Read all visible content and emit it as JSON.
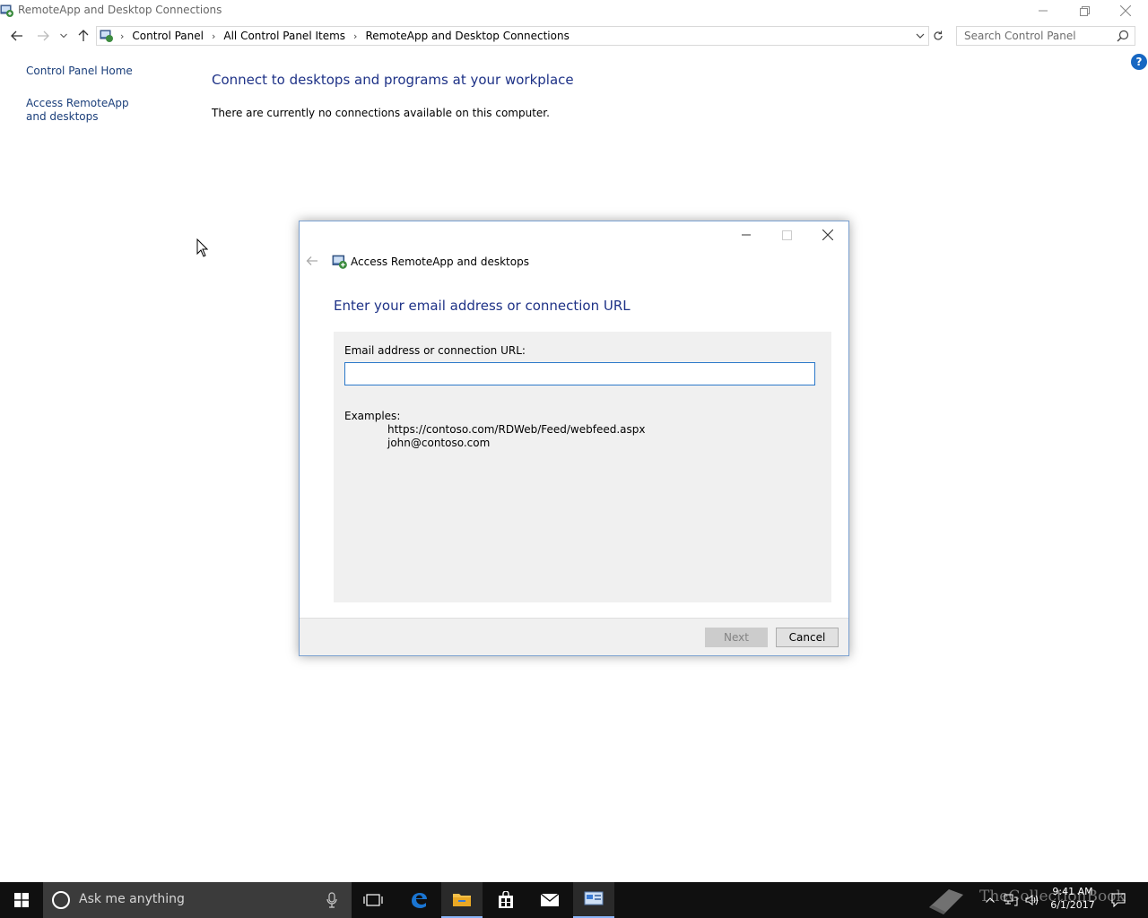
{
  "window": {
    "title": "RemoteApp and Desktop Connections"
  },
  "address": {
    "crumbs": [
      "Control Panel",
      "All Control Panel Items",
      "RemoteApp and Desktop Connections"
    ]
  },
  "search": {
    "placeholder": "Search Control Panel"
  },
  "help": {
    "label": "?"
  },
  "left_pane": {
    "home": "Control Panel Home",
    "access": "Access RemoteApp and desktops"
  },
  "main": {
    "title": "Connect to desktops and programs at your workplace",
    "text": "There are currently no connections available on this computer."
  },
  "dialog": {
    "title": "Access RemoteApp and desktops",
    "heading": "Enter your email address or connection URL",
    "field_label": "Email address or connection URL:",
    "field_value": "",
    "examples_label": "Examples:",
    "example_1": "https://contoso.com/RDWeb/Feed/webfeed.aspx",
    "example_2": "john@contoso.com",
    "next_label": "Next",
    "cancel_label": "Cancel"
  },
  "taskbar": {
    "search_placeholder": "Ask me anything",
    "time": "9:41 AM",
    "date": "6/1/2017",
    "watermark": "TheCollectionBook"
  },
  "colors": {
    "link": "#1a3e7a",
    "heading": "#1e3287",
    "accent": "#2b78c9",
    "taskbar": "#101010"
  }
}
